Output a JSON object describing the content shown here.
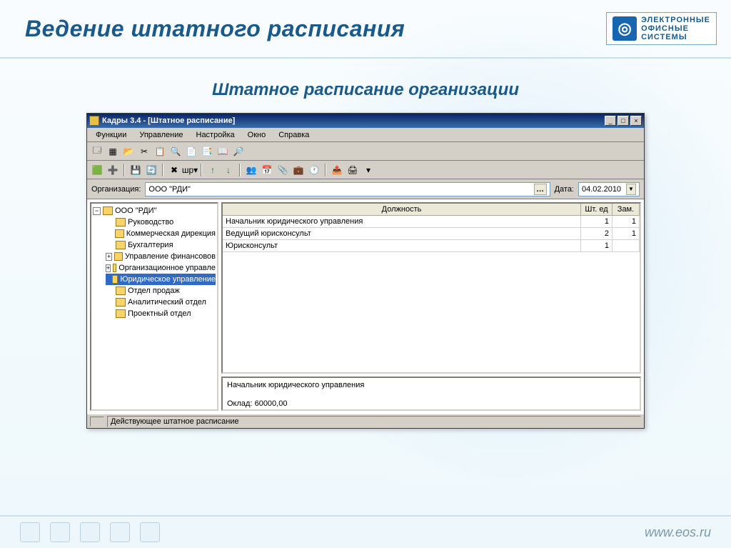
{
  "slide": {
    "title": "Ведение штатного расписания",
    "subtitle": "Штатное расписание организации",
    "logo_line1": "ЭЛЕКТРОННЫЕ",
    "logo_line2": "ОФИСНЫЕ",
    "logo_line3": "СИСТЕМЫ",
    "footer_url": "www.eos.ru"
  },
  "window": {
    "title": "Кадры 3.4 - [Штатное расписание]",
    "menus": [
      "Функции",
      "Управление",
      "Настройка",
      "Окно",
      "Справка"
    ]
  },
  "filter": {
    "org_label": "Организация:",
    "org_value": "ООО \"РДИ\"",
    "date_label": "Дата:",
    "date_value": "04.02.2010"
  },
  "tree": {
    "root": "ООО \"РДИ\"",
    "children": [
      {
        "label": "Руководство"
      },
      {
        "label": "Коммерческая дирекция"
      },
      {
        "label": "Бухгалтерия"
      },
      {
        "label": "Управление финансовов",
        "expandable": true
      },
      {
        "label": "Организационное управле",
        "expandable": true
      },
      {
        "label": "Юридическое управление",
        "selected": true
      },
      {
        "label": "Отдел продаж"
      },
      {
        "label": "Аналитический отдел"
      },
      {
        "label": "Проектный отдел"
      }
    ]
  },
  "grid": {
    "headers": {
      "c1": "Должность",
      "c2": "Шт. ед",
      "c3": "Зам."
    },
    "rows": [
      {
        "c1": "Начальник юридического управления",
        "c2": "1",
        "c3": "1"
      },
      {
        "c1": "Ведущий юрисконсульт",
        "c2": "2",
        "c3": "1"
      },
      {
        "c1": "Юрисконсульт",
        "c2": "1",
        "c3": ""
      }
    ]
  },
  "detail": {
    "position": "Начальник юридического управления",
    "salary_label": "Оклад:",
    "salary": "60000,00"
  },
  "status": "Действующее штатное расписание"
}
